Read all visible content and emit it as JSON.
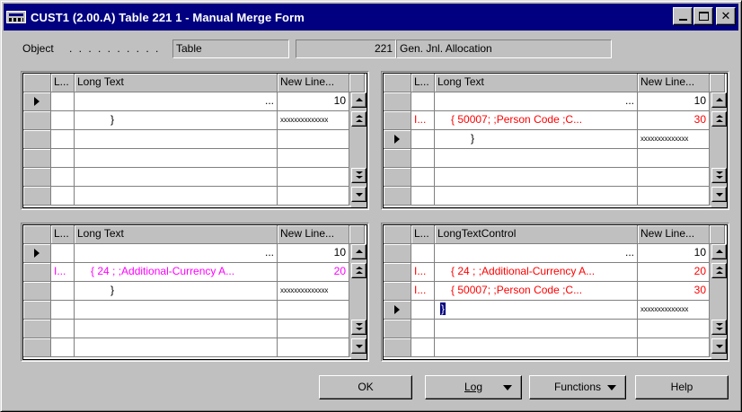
{
  "window": {
    "title": "CUST1 (2.00.A) Table 221 1 - Manual Merge Form",
    "minimize": "_",
    "maximize": "□",
    "close": "✕"
  },
  "object_row": {
    "label": "Object",
    "dots": ". . . . . . . . . .",
    "type": "Table",
    "number": "221",
    "name": "Gen. Jnl. Allocation"
  },
  "grids": {
    "top_left": {
      "headers": [
        "L...",
        "Long Text",
        "New Line..."
      ],
      "rows": [
        {
          "l": "",
          "text": "...",
          "num": "10",
          "color": "black",
          "active": true
        },
        {
          "l": "",
          "text": "}",
          "num": "xxxxxxxxxxxxxx",
          "color": "black",
          "active": false
        },
        {
          "l": "",
          "text": "",
          "num": "",
          "color": "black",
          "active": false
        },
        {
          "l": "",
          "text": "",
          "num": "",
          "color": "black",
          "active": false
        },
        {
          "l": "",
          "text": "",
          "num": "",
          "color": "black",
          "active": false
        },
        {
          "l": "",
          "text": "",
          "num": "",
          "color": "black",
          "active": false
        }
      ]
    },
    "top_right": {
      "headers": [
        "L...",
        "Long Text",
        "New Line..."
      ],
      "rows": [
        {
          "l": "",
          "text": "...",
          "num": "10",
          "color": "black",
          "active": false
        },
        {
          "l": "I...",
          "text": "{ 50007;  ;Person Code          ;C...",
          "num": "30",
          "color": "red",
          "active": false
        },
        {
          "l": "",
          "text": "}",
          "num": "xxxxxxxxxxxxxx",
          "color": "black",
          "active": true
        },
        {
          "l": "",
          "text": "",
          "num": "",
          "color": "black",
          "active": false
        },
        {
          "l": "",
          "text": "",
          "num": "",
          "color": "black",
          "active": false
        },
        {
          "l": "",
          "text": "",
          "num": "",
          "color": "black",
          "active": false
        }
      ]
    },
    "bottom_left": {
      "headers": [
        "L...",
        "Long Text",
        "New Line..."
      ],
      "rows": [
        {
          "l": "",
          "text": "...",
          "num": "10",
          "color": "black",
          "active": true
        },
        {
          "l": "I...",
          "text": "{ 24  ;   ;Additional-Currency A...",
          "num": "20",
          "color": "magenta",
          "active": false
        },
        {
          "l": "",
          "text": "}",
          "num": "xxxxxxxxxxxxxx",
          "color": "black",
          "active": false
        },
        {
          "l": "",
          "text": "",
          "num": "",
          "color": "black",
          "active": false
        },
        {
          "l": "",
          "text": "",
          "num": "",
          "color": "black",
          "active": false
        },
        {
          "l": "",
          "text": "",
          "num": "",
          "color": "black",
          "active": false
        }
      ]
    },
    "bottom_right": {
      "headers": [
        "L...",
        "LongTextControl",
        "New Line..."
      ],
      "rows": [
        {
          "l": "",
          "text": "...",
          "num": "10",
          "color": "black",
          "active": false
        },
        {
          "l": "I...",
          "text": "{ 24  ;   ;Additional-Currency A...",
          "num": "20",
          "color": "red",
          "active": false
        },
        {
          "l": "I...",
          "text": "{ 50007;  ;Person Code          ;C...",
          "num": "30",
          "color": "red",
          "active": false
        },
        {
          "l": "",
          "text": "}",
          "num": "xxxxxxxxxxxxxx",
          "color": "black",
          "active": true,
          "selected_text": true
        },
        {
          "l": "",
          "text": "",
          "num": "",
          "color": "black",
          "active": false
        },
        {
          "l": "",
          "text": "",
          "num": "",
          "color": "black",
          "active": false
        }
      ]
    }
  },
  "buttons": {
    "ok": "OK",
    "log": "Log",
    "functions": "Functions",
    "help": "Help"
  },
  "colors": {
    "titlebar": "#000080",
    "face": "#c0c0c0",
    "conflict_red": "#ff0000",
    "conflict_magenta": "#ff00ff"
  }
}
